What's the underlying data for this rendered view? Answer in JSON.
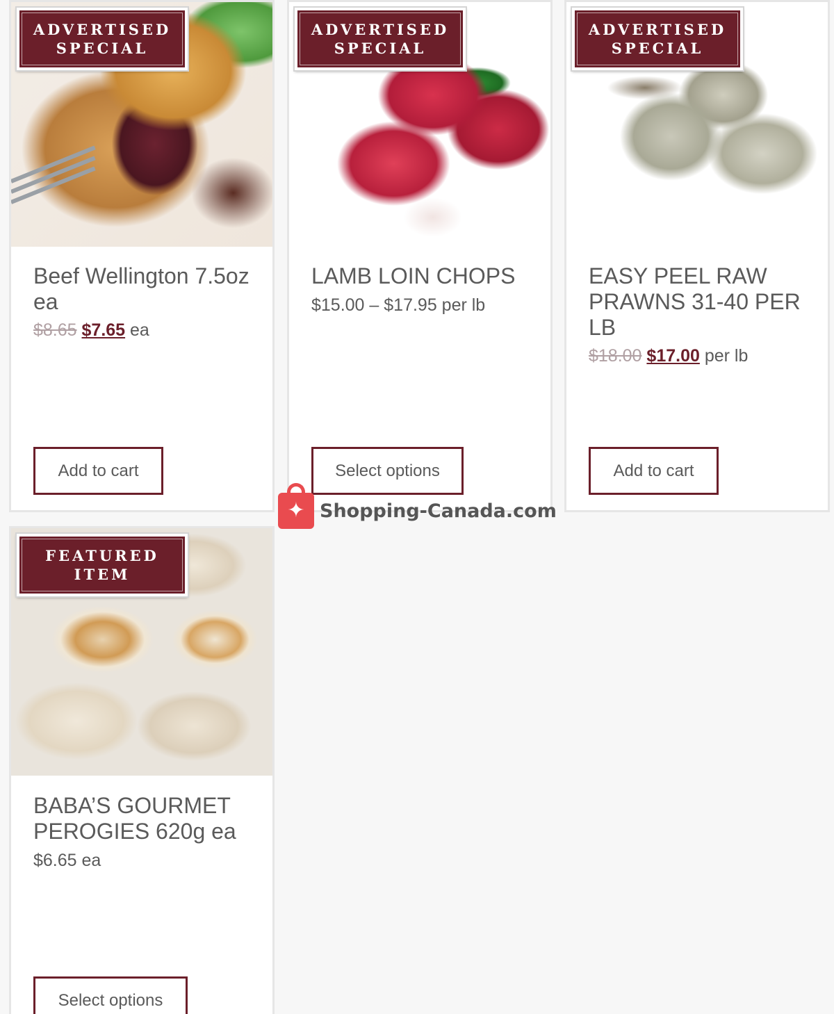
{
  "products": [
    {
      "badge": "ADVERTISED\nSPECIAL",
      "title": "Beef Wellington 7.5oz ea",
      "old_price": "$8.65",
      "new_price": "$7.65",
      "unit": "ea",
      "button": "Add to cart",
      "image_icon": "beef-wellington-photo"
    },
    {
      "badge": "ADVERTISED\nSPECIAL",
      "title": "LAMB LOIN CHOPS",
      "price_range": "$15.00 – $17.95 per lb",
      "button": "Select options",
      "image_icon": "lamb-chops-photo"
    },
    {
      "badge": "ADVERTISED\nSPECIAL",
      "title": "EASY PEEL RAW PRAWNS 31-40 PER LB",
      "old_price": "$18.00",
      "new_price": "$17.00",
      "unit": "per lb",
      "button": "Add to cart",
      "image_icon": "prawns-photo"
    },
    {
      "badge": "FEATURED\nITEM",
      "title": "BABA’S GOURMET PEROGIES 620g ea",
      "price": "$6.65 ea",
      "button": "Select options",
      "image_icon": "perogies-photo"
    }
  ],
  "watermark": {
    "text": "Shopping-Canada.com",
    "icon": "maple-leaf-bag-icon"
  },
  "colors": {
    "accent": "#6b1f2a",
    "text": "#5a5a5a",
    "old_price": "#b0a0a3",
    "watermark": "#e94b4f"
  }
}
